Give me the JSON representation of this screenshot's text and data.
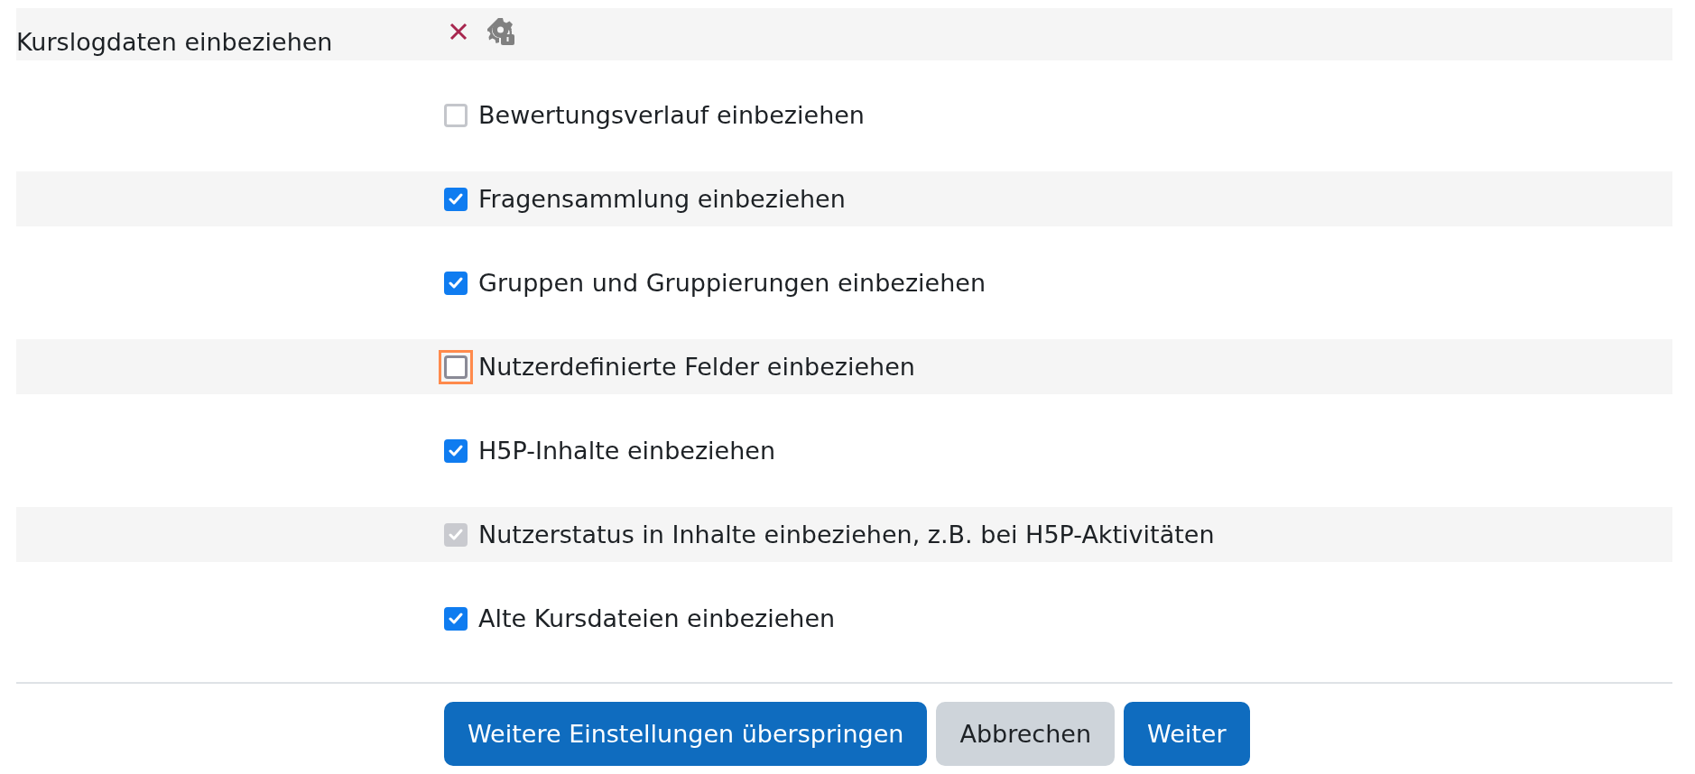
{
  "locked_setting": {
    "label": "Kurslogdaten einbeziehen",
    "included": false
  },
  "options": [
    {
      "label": "Bewertungsverlauf einbeziehen",
      "checked": false,
      "disabled": false,
      "focused": false
    },
    {
      "label": "Fragensammlung einbeziehen",
      "checked": true,
      "disabled": false,
      "focused": false
    },
    {
      "label": "Gruppen und Gruppierungen einbeziehen",
      "checked": true,
      "disabled": false,
      "focused": false
    },
    {
      "label": "Nutzerdefinierte Felder einbeziehen",
      "checked": false,
      "disabled": false,
      "focused": true
    },
    {
      "label": "H5P-Inhalte einbeziehen",
      "checked": true,
      "disabled": false,
      "focused": false
    },
    {
      "label": "Nutzerstatus in Inhalte einbeziehen, z.B. bei H5P-Aktivitäten",
      "checked": true,
      "disabled": true,
      "focused": false
    },
    {
      "label": "Alte Kursdateien einbeziehen",
      "checked": true,
      "disabled": false,
      "focused": false
    }
  ],
  "buttons": [
    {
      "label": "Weitere Einstellungen überspringen",
      "kind": "primary"
    },
    {
      "label": "Abbrechen",
      "kind": "secondary"
    },
    {
      "label": "Weiter",
      "kind": "primary"
    }
  ]
}
